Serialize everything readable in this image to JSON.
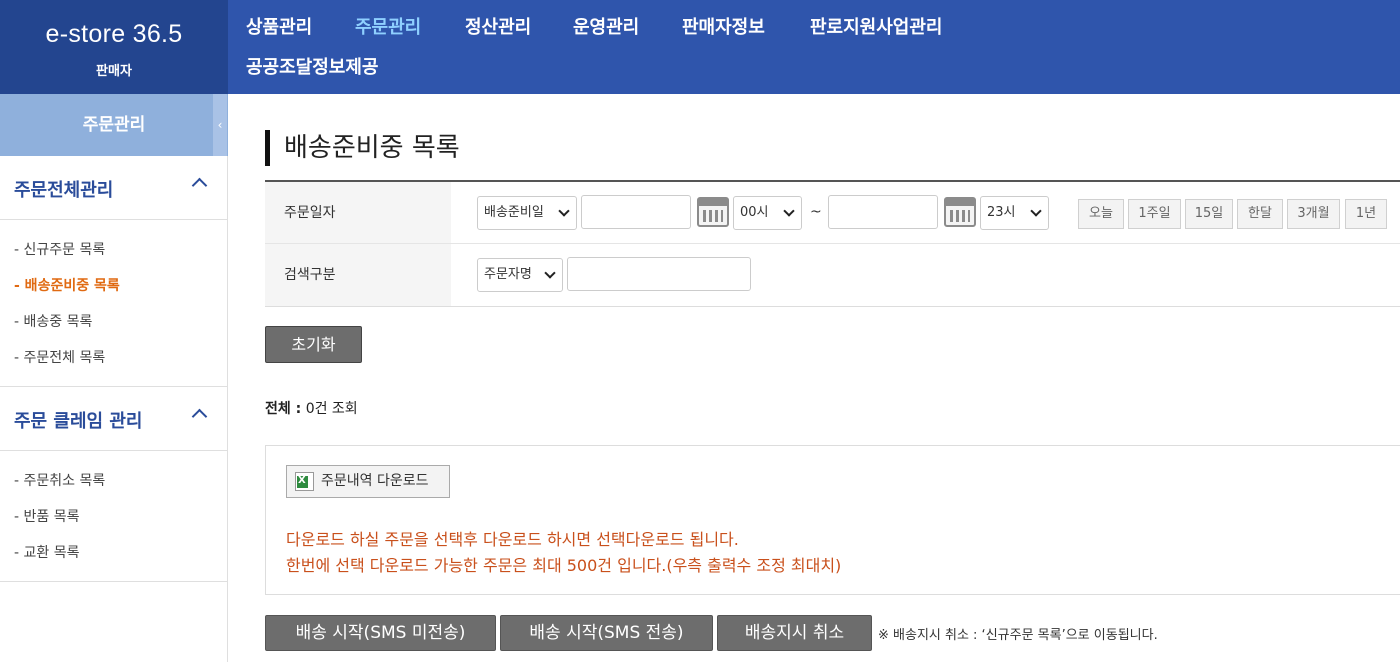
{
  "header": {
    "logo_title": "e-store 36.5",
    "logo_sub": "판매자",
    "nav": [
      "상품관리",
      "주문관리",
      "정산관리",
      "운영관리",
      "판매자정보",
      "판로지원사업관리",
      "공공조달정보제공"
    ],
    "active_nav": "주문관리"
  },
  "sidebar": {
    "title": "주문관리",
    "toggle": "‹",
    "groups": [
      {
        "title": "주문전체관리",
        "items": [
          "- 신규주문 목록",
          "- 배송준비중 목록",
          "- 배송중 목록",
          "- 주문전체 목록"
        ]
      },
      {
        "title": "주문 클레임 관리",
        "items": [
          "- 주문취소 목록",
          "- 반품 목록",
          "- 교환 목록"
        ]
      }
    ],
    "active_item": "- 배송준비중 목록"
  },
  "main": {
    "title": "배송준비중 목록",
    "search": {
      "date_label": "주문일자",
      "date_type": "배송준비일",
      "start_date": "",
      "start_hour": "00시",
      "tilde": "~",
      "end_date": "",
      "end_hour": "23시",
      "quick_ranges": [
        "오늘",
        "1주일",
        "15일",
        "한달",
        "3개월",
        "1년"
      ],
      "keyword_label": "검색구분",
      "keyword_type": "주문자명",
      "keyword": ""
    },
    "reset_label": "초기화",
    "total": {
      "label": "전체 :",
      "value": "0건 조회"
    },
    "download": {
      "button_label": "주문내역 다운로드",
      "icon": "excel-icon",
      "notice_1": "다운로드 하실 주문을 선택후 다운로드 하시면 선택다운로드 됩니다.",
      "notice_2": "한번에 선택 다운로드 가능한 주문은 최대 500건 입니다.(우측 출력수 조정 최대치)"
    },
    "actions": [
      "배송 시작(SMS 미전송)",
      "배송 시작(SMS 전송)",
      "배송지시 취소"
    ],
    "action_note": "※ 배송지시 취소 : ‘신규주문 목록’으로 이동됩니다."
  },
  "colors": {
    "header": "#2f55ac",
    "logo_bg": "#23458f",
    "side_head": "#8fb0dc",
    "active_nav": "#8fd0ff",
    "active_side": "#e06a12",
    "notice": "#c9501c"
  }
}
